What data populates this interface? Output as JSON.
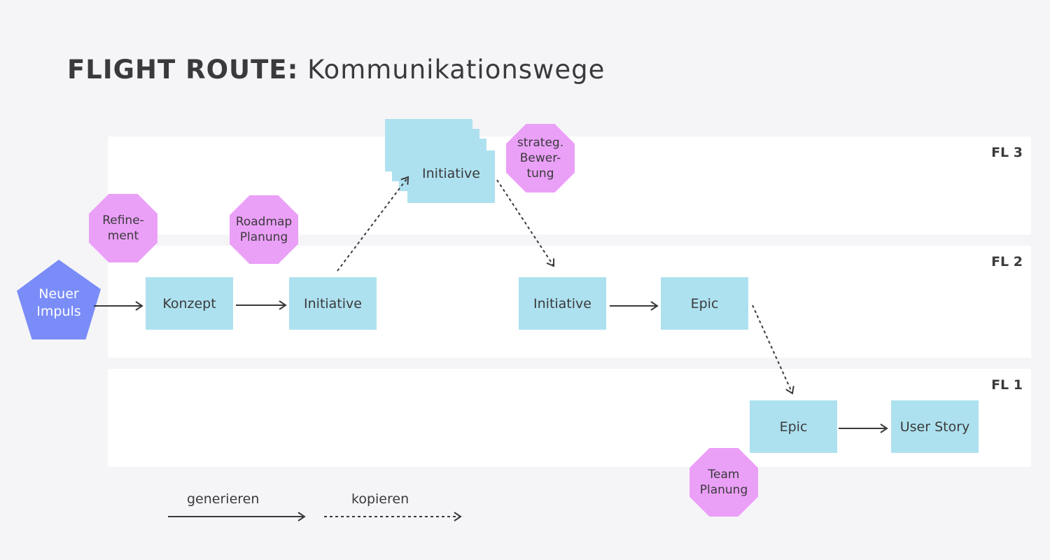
{
  "title": {
    "bold": "FLIGHT ROUTE:",
    "rest": " Kommunikationswege"
  },
  "colors": {
    "background": "#f5f5f7",
    "lane": "#ffffff",
    "box": "#aee1ef",
    "event": "#eba0f8",
    "start": "#7a8cf8",
    "text": "#3a3a3c"
  },
  "lanes": [
    {
      "id": "fl3",
      "label": "FL 3"
    },
    {
      "id": "fl2",
      "label": "FL 2"
    },
    {
      "id": "fl1",
      "label": "FL 1"
    }
  ],
  "start": {
    "label": "Neuer\nImpuls",
    "shape": "pentagon"
  },
  "boxes": [
    {
      "id": "konzept",
      "label": "Konzept",
      "lane": "FL 2"
    },
    {
      "id": "initiative-fl2a",
      "label": "Initiative",
      "lane": "FL 2"
    },
    {
      "id": "initiative-fl3",
      "label": "Initiative",
      "lane": "FL 3",
      "stacked": true
    },
    {
      "id": "initiative-fl2b",
      "label": "Initiative",
      "lane": "FL 2"
    },
    {
      "id": "epic-fl2",
      "label": "Epic",
      "lane": "FL 2"
    },
    {
      "id": "epic-fl1",
      "label": "Epic",
      "lane": "FL 1"
    },
    {
      "id": "user-story",
      "label": "User Story",
      "lane": "FL 1"
    }
  ],
  "events": [
    {
      "id": "refinement",
      "label": "Refine-\nment"
    },
    {
      "id": "roadmap",
      "label": "Roadmap\nPlanung"
    },
    {
      "id": "strateg",
      "label": "strateg.\nBewer-\ntung"
    },
    {
      "id": "team",
      "label": "Team\nPlanung"
    }
  ],
  "edges": [
    {
      "from": "start",
      "to": "konzept",
      "type": "generieren"
    },
    {
      "from": "konzept",
      "to": "initiative-fl2a",
      "type": "generieren"
    },
    {
      "from": "initiative-fl2a",
      "to": "initiative-fl3",
      "type": "kopieren"
    },
    {
      "from": "initiative-fl3",
      "to": "initiative-fl2b",
      "type": "kopieren"
    },
    {
      "from": "initiative-fl2b",
      "to": "epic-fl2",
      "type": "generieren"
    },
    {
      "from": "epic-fl2",
      "to": "epic-fl1",
      "type": "kopieren"
    },
    {
      "from": "epic-fl1",
      "to": "user-story",
      "type": "generieren"
    }
  ],
  "legend": {
    "solid": "generieren",
    "dashed": "kopieren"
  }
}
